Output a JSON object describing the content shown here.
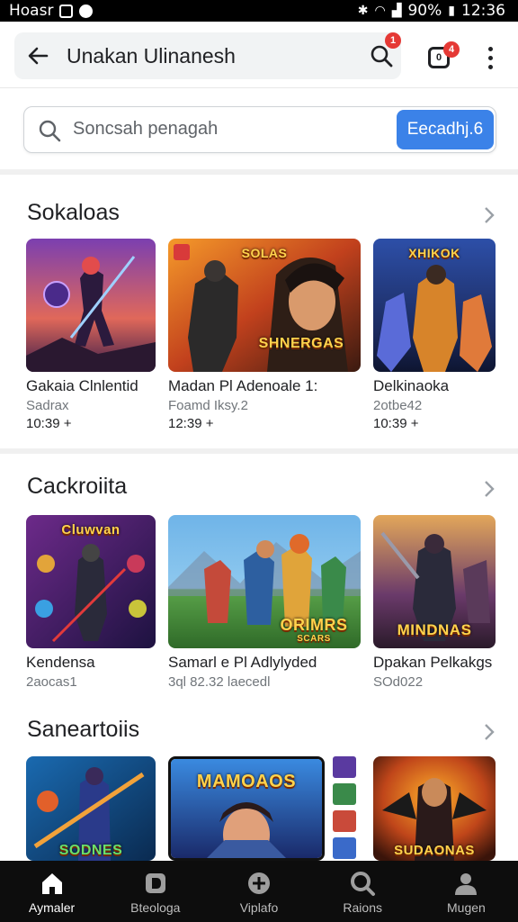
{
  "status_bar": {
    "left_text": "Hoasr",
    "battery": "90%",
    "time": "12:36"
  },
  "app_bar": {
    "title": "Unakan Ulinanesh",
    "search_badge": "1",
    "notif_badge": "4",
    "notif_box_text": "0"
  },
  "search": {
    "placeholder": "Soncsah penagah",
    "button_label": "Eecadhj.6"
  },
  "sections": [
    {
      "title": "Sokaloas",
      "cards": [
        {
          "title": "Gakaia Clnlentid",
          "sub": "Sadrax",
          "time": "10:39 +"
        },
        {
          "title": "Madan Pl Adenoale 1:",
          "sub": "Foamd Iksy.2",
          "time": "12:39 +",
          "art_label": "SHNERGAS",
          "art_top": "SOLAS"
        },
        {
          "title": "Delkinaoka",
          "sub": "2otbe42",
          "time": "10:39 +",
          "art_top": "XHIKOK"
        }
      ]
    },
    {
      "title": "Cackroiita",
      "cards": [
        {
          "title": "Kendensa",
          "sub": "2aocas1",
          "art_top": "Cluwvan"
        },
        {
          "title": "Samarl e Pl Adlylyded",
          "sub": "3ql 82.32 laecedl",
          "art_label": "ORIMRS",
          "art_small": "SCARS"
        },
        {
          "title": "Dpakan Pelkakgs",
          "sub": "SOd022",
          "art_label": "MINDNAS"
        }
      ]
    },
    {
      "title": "Saneartoiis",
      "cards": [
        {
          "art_label": "SODNES"
        },
        {
          "art_label": "MAMOAOS"
        },
        {
          "art_label": "SUDAONAS"
        }
      ]
    }
  ],
  "bottom_nav": [
    {
      "label": "Aymaler",
      "icon": "home-icon",
      "active": true
    },
    {
      "label": "Bteologa",
      "icon": "library-icon",
      "active": false
    },
    {
      "label": "Viplafo",
      "icon": "add-circle-icon",
      "active": false
    },
    {
      "label": "Raions",
      "icon": "search-icon",
      "active": false
    },
    {
      "label": "Mugen",
      "icon": "profile-icon",
      "active": false
    }
  ],
  "colors": {
    "accent": "#3b82e8",
    "badge": "#e53935",
    "nav_bg": "#0d0d0d"
  }
}
